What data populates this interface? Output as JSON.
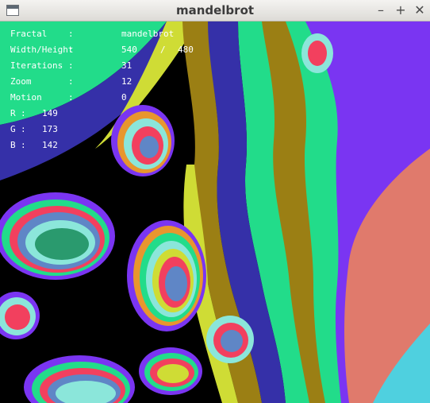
{
  "window": {
    "title": "mandelbrot",
    "controls": {
      "minimize": "–",
      "maximize": "+",
      "close": "✕"
    },
    "app_icon": "window-icon"
  },
  "colors": {
    "background": "#000000",
    "purple": "#7a35f2",
    "salmon": "#e07a6c",
    "cyan": "#4fd0df",
    "green": "#22dc8a",
    "olive": "#9b7f14",
    "navy": "#3530a8",
    "yellow": "#cfdc35",
    "slate": "#5f86c6",
    "aqua": "#8be6da",
    "red": "#f2405e",
    "teal": "#2a9a6e",
    "orange": "#e8962e"
  },
  "overlay": {
    "fractal": {
      "label": "Fractal",
      "colon": ":",
      "value": "mandelbrot"
    },
    "size": {
      "label": "Width/Height",
      "colon": ":",
      "width": "540",
      "slash": "/",
      "height": "480"
    },
    "iterations": {
      "label": "Iterations",
      "colon": ":",
      "value": "31"
    },
    "zoom": {
      "label": "Zoom",
      "colon": ":",
      "value": "12"
    },
    "motion": {
      "label": "Motion",
      "colon": ":",
      "value": "0"
    },
    "r": {
      "label": "R",
      "colon": ":",
      "value": "149"
    },
    "g": {
      "label": "G",
      "colon": ":",
      "value": "173"
    },
    "b": {
      "label": "B",
      "colon": ":",
      "value": "142"
    }
  }
}
